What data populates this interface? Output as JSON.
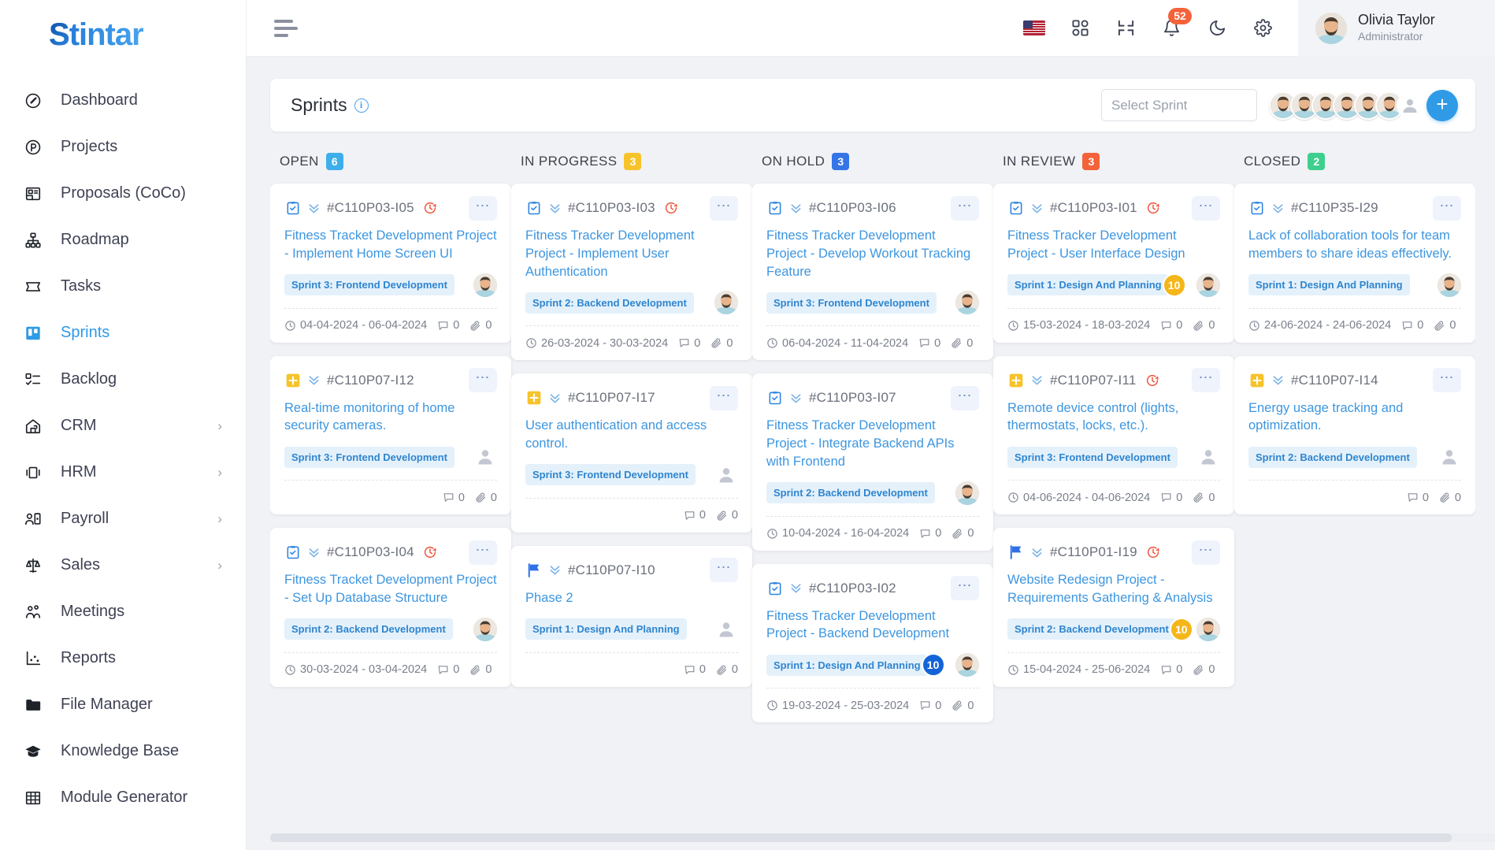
{
  "sidebar": {
    "logo": {
      "prefix": "S",
      "rest": "tintar"
    },
    "items": [
      {
        "label": "Dashboard",
        "icon": "gauge-icon",
        "active": false,
        "expandable": false
      },
      {
        "label": "Projects",
        "icon": "projects-icon",
        "active": false,
        "expandable": false
      },
      {
        "label": "Proposals (CoCo)",
        "icon": "proposals-icon",
        "active": false,
        "expandable": false
      },
      {
        "label": "Roadmap",
        "icon": "roadmap-icon",
        "active": false,
        "expandable": false
      },
      {
        "label": "Tasks",
        "icon": "tasks-icon",
        "active": false,
        "expandable": false
      },
      {
        "label": "Sprints",
        "icon": "sprints-icon",
        "active": true,
        "expandable": false
      },
      {
        "label": "Backlog",
        "icon": "backlog-icon",
        "active": false,
        "expandable": false
      },
      {
        "label": "CRM",
        "icon": "crm-icon",
        "active": false,
        "expandable": true
      },
      {
        "label": "HRM",
        "icon": "hrm-icon",
        "active": false,
        "expandable": true
      },
      {
        "label": "Payroll",
        "icon": "payroll-icon",
        "active": false,
        "expandable": true
      },
      {
        "label": "Sales",
        "icon": "sales-icon",
        "active": false,
        "expandable": true
      },
      {
        "label": "Meetings",
        "icon": "meetings-icon",
        "active": false,
        "expandable": false
      },
      {
        "label": "Reports",
        "icon": "reports-icon",
        "active": false,
        "expandable": false
      },
      {
        "label": "File Manager",
        "icon": "folder-icon",
        "active": false,
        "expandable": false
      },
      {
        "label": "Knowledge Base",
        "icon": "graduation-cap-icon",
        "active": false,
        "expandable": false
      },
      {
        "label": "Module Generator",
        "icon": "grid-table-icon",
        "active": false,
        "expandable": false
      }
    ]
  },
  "topbar": {
    "menu_icon": "hamburger-menu-icon",
    "icons": [
      {
        "name": "language-flag-icon",
        "label": "US"
      },
      {
        "name": "apps-grid-icon",
        "label": ""
      },
      {
        "name": "compress-icon",
        "label": ""
      },
      {
        "name": "notification-bell-icon",
        "label": "",
        "badge": "52"
      },
      {
        "name": "dark-mode-moon-icon",
        "label": ""
      },
      {
        "name": "settings-gear-icon",
        "label": ""
      }
    ],
    "notification_count": "52",
    "user": {
      "name": "Olivia Taylor",
      "role": "Administrator"
    }
  },
  "page": {
    "title": "Sprints",
    "info_icon": "info-icon",
    "select_sprint_placeholder": "Select Sprint",
    "avatar_count": 6,
    "add_button_label": "+"
  },
  "colors": {
    "open": "#3eaeeb",
    "in_progress": "#f6c32a",
    "on_hold": "#3575e8",
    "in_review": "#f4623a",
    "closed": "#3ecf8e",
    "accent": "#2f9ae6",
    "card_title": "#3d96e0"
  },
  "board": {
    "columns": [
      {
        "title": "OPEN",
        "count": "6",
        "count_color": "#3eaeeb",
        "cards": [
          {
            "type_icon": "clipboard-check-icon",
            "type_color": "#2f85e0",
            "id": "#C110P03-I05",
            "overdue": true,
            "title": "Fitness Tracket Development Project - Implement Home Screen UI",
            "sprint": "Sprint 3: Frontend Development",
            "badge": null,
            "badge_color": null,
            "assignee": true,
            "dates": "04-04-2024 - 06-04-2024",
            "comments": "0",
            "attachments": "0"
          },
          {
            "type_icon": "plus-square-icon",
            "type_color": "#f6c32a",
            "id": "#C110P07-I12",
            "overdue": false,
            "title": "Real-time monitoring of home security cameras.",
            "sprint": "Sprint 3: Frontend Development",
            "badge": null,
            "badge_color": null,
            "assignee": false,
            "dates": "",
            "comments": "0",
            "attachments": "0"
          },
          {
            "type_icon": "clipboard-check-icon",
            "type_color": "#2f85e0",
            "id": "#C110P03-I04",
            "overdue": true,
            "title": "Fitness Tracket Development Project - Set Up Database Structure",
            "sprint": "Sprint 2: Backend Development",
            "badge": null,
            "badge_color": null,
            "assignee": true,
            "dates": "30-03-2024 - 03-04-2024",
            "comments": "0",
            "attachments": "0"
          }
        ]
      },
      {
        "title": "IN PROGRESS",
        "count": "3",
        "count_color": "#f6c32a",
        "cards": [
          {
            "type_icon": "clipboard-check-icon",
            "type_color": "#2f85e0",
            "id": "#C110P03-I03",
            "overdue": true,
            "title": "Fitness Tracker Development Project - Implement User Authentication",
            "sprint": "Sprint 2: Backend Development",
            "badge": null,
            "badge_color": null,
            "assignee": true,
            "dates": "26-03-2024 - 30-03-2024",
            "comments": "0",
            "attachments": "0"
          },
          {
            "type_icon": "plus-square-icon",
            "type_color": "#f6c32a",
            "id": "#C110P07-I17",
            "overdue": false,
            "title": "User authentication and access control.",
            "sprint": "Sprint 3: Frontend Development",
            "badge": null,
            "badge_color": null,
            "assignee": false,
            "dates": "",
            "comments": "0",
            "attachments": "0"
          },
          {
            "type_icon": "flag-icon",
            "type_color": "#2f6fe8",
            "id": "#C110P07-I10",
            "overdue": false,
            "title": "Phase 2",
            "sprint": "Sprint 1: Design And Planning",
            "badge": null,
            "badge_color": null,
            "assignee": false,
            "dates": "",
            "comments": "0",
            "attachments": "0"
          }
        ]
      },
      {
        "title": "ON HOLD",
        "count": "3",
        "count_color": "#3575e8",
        "cards": [
          {
            "type_icon": "clipboard-check-icon",
            "type_color": "#2f85e0",
            "id": "#C110P03-I06",
            "overdue": false,
            "title": "Fitness Tracker Development Project - Develop Workout Tracking Feature",
            "sprint": "Sprint 3: Frontend Development",
            "badge": null,
            "badge_color": null,
            "assignee": true,
            "dates": "06-04-2024 - 11-04-2024",
            "comments": "0",
            "attachments": "0"
          },
          {
            "type_icon": "clipboard-check-icon",
            "type_color": "#2f85e0",
            "id": "#C110P03-I07",
            "overdue": false,
            "title": "Fitness Tracker Development Project - Integrate Backend APIs with Frontend",
            "sprint": "Sprint 2: Backend Development",
            "badge": null,
            "badge_color": null,
            "assignee": true,
            "dates": "10-04-2024 - 16-04-2024",
            "comments": "0",
            "attachments": "0"
          },
          {
            "type_icon": "clipboard-check-icon",
            "type_color": "#2f85e0",
            "id": "#C110P03-I02",
            "overdue": false,
            "title": "Fitness Tracker Development Project - Backend Development",
            "sprint": "Sprint 1: Design And Planning",
            "badge": "10",
            "badge_color": "#1464d8",
            "assignee": true,
            "dates": "19-03-2024 - 25-03-2024",
            "comments": "0",
            "attachments": "0"
          }
        ]
      },
      {
        "title": "IN REVIEW",
        "count": "3",
        "count_color": "#f4623a",
        "cards": [
          {
            "type_icon": "clipboard-check-icon",
            "type_color": "#2f85e0",
            "id": "#C110P03-I01",
            "overdue": true,
            "title": "Fitness Tracker Development Project - User Interface Design",
            "sprint": "Sprint 1: Design And Planning",
            "badge": "10",
            "badge_color": "#f5b619",
            "assignee": true,
            "dates": "15-03-2024 - 18-03-2024",
            "comments": "0",
            "attachments": "0"
          },
          {
            "type_icon": "plus-square-icon",
            "type_color": "#f6c32a",
            "id": "#C110P07-I11",
            "overdue": true,
            "title": "Remote device control (lights, thermostats, locks, etc.).",
            "sprint": "Sprint 3: Frontend Development",
            "badge": null,
            "badge_color": null,
            "assignee": false,
            "dates": "04-06-2024 - 04-06-2024",
            "comments": "0",
            "attachments": "0"
          },
          {
            "type_icon": "flag-icon",
            "type_color": "#2f6fe8",
            "id": "#C110P01-I19",
            "overdue": true,
            "title": "Website Redesign Project - Requirements Gathering & Analysis",
            "sprint": "Sprint 2: Backend Development",
            "badge": "10",
            "badge_color": "#f5b619",
            "assignee": true,
            "dates": "15-04-2024 - 25-06-2024",
            "comments": "0",
            "attachments": "0"
          }
        ]
      },
      {
        "title": "CLOSED",
        "count": "2",
        "count_color": "#3ecf8e",
        "cards": [
          {
            "type_icon": "clipboard-check-icon",
            "type_color": "#2f85e0",
            "id": "#C110P35-I29",
            "overdue": false,
            "title": "Lack of collaboration tools for team members to share ideas effectively.",
            "sprint": "Sprint 1: Design And Planning",
            "badge": null,
            "badge_color": null,
            "assignee": true,
            "dates": "24-06-2024 - 24-06-2024",
            "comments": "0",
            "attachments": "0"
          },
          {
            "type_icon": "plus-square-icon",
            "type_color": "#f6c32a",
            "id": "#C110P07-I14",
            "overdue": false,
            "title": "Energy usage tracking and optimization.",
            "sprint": "Sprint 2: Backend Development",
            "badge": null,
            "badge_color": null,
            "assignee": false,
            "dates": "",
            "comments": "0",
            "attachments": "0"
          }
        ]
      }
    ]
  }
}
